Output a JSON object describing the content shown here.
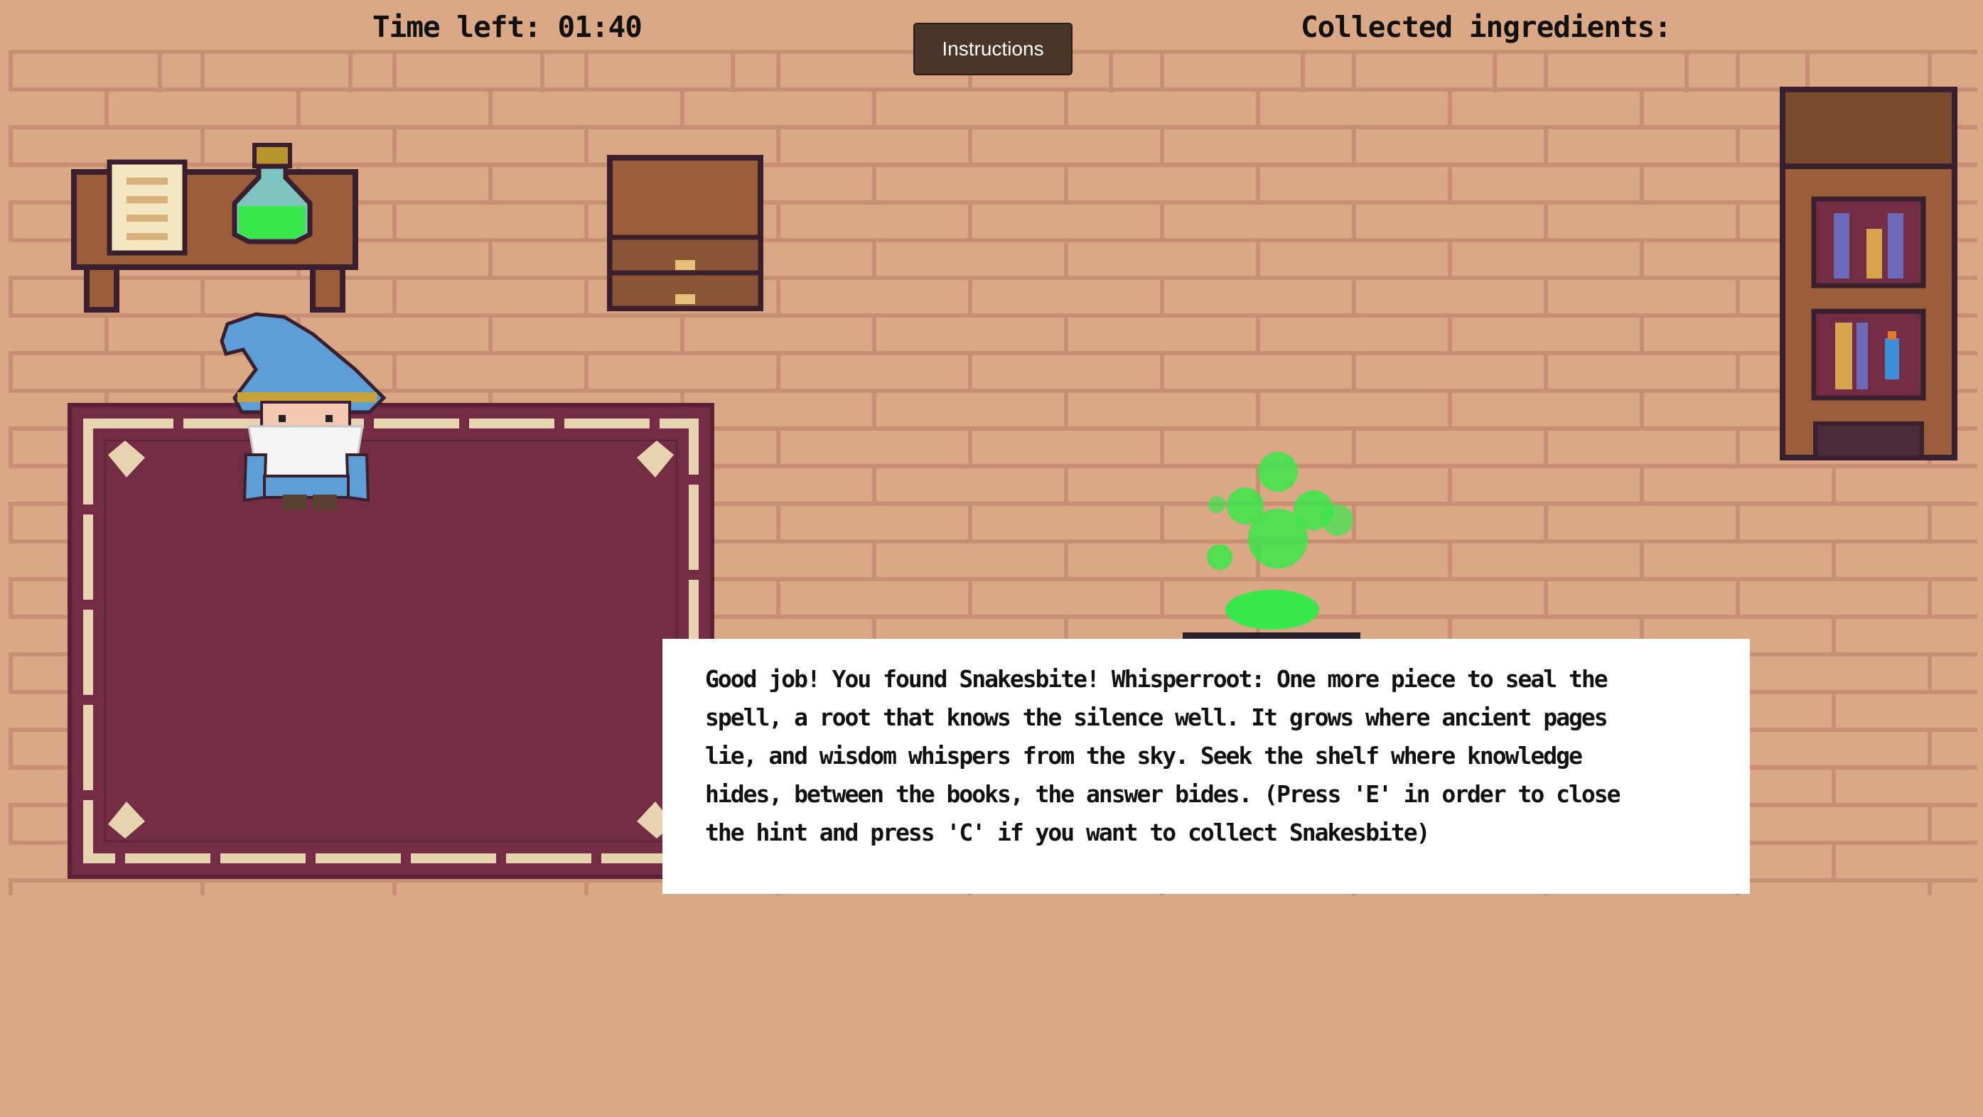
{
  "hud": {
    "timer_label": "Time left: 01:40",
    "ingredients_label": "Collected ingredients:"
  },
  "buttons": {
    "instructions_label": "Instructions"
  },
  "hint": {
    "text": "Good job! You found Snakesbite! Whisperroot: One more piece to seal the spell, a root that knows the silence well. It grows where ancient pages lie, and wisdom whispers from the sky. Seek the shelf where knowledge hides, between the books, the answer bides. (Press 'E' in order to close the hint and press 'C' if you want to collect Snakesbite)"
  },
  "colors": {
    "floor": "#dba885",
    "brick_line": "#c98f72",
    "rug": "#722d45",
    "rug_border": "#e8d3b0",
    "wood": "#9a5e3b",
    "outline": "#3a1f2f",
    "potion_green": "#38e84a",
    "wizard_blue": "#5b9fd6",
    "button_bg": "#4a3529"
  },
  "icons": {
    "character": "wizard-sprite",
    "cauldron": "bubbling-cauldron-icon",
    "potion": "green-potion-icon",
    "scroll": "scroll-icon",
    "bookshelf": "bookshelf-icon",
    "drawer": "drawer-cabinet-icon"
  }
}
